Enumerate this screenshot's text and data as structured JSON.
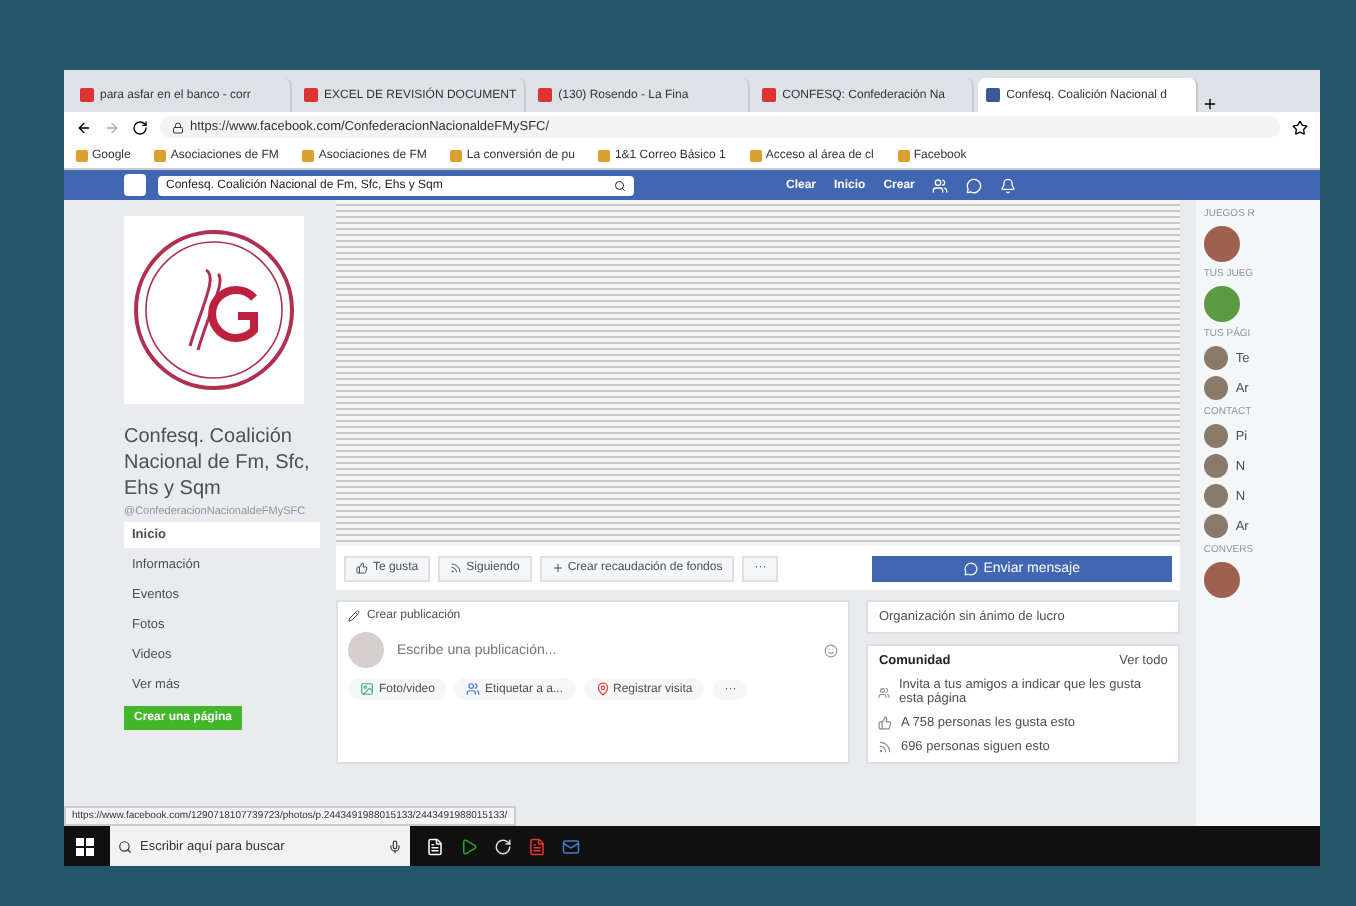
{
  "browser": {
    "tabs": [
      {
        "title": "para asfar en el banco - corr",
        "selected": false
      },
      {
        "title": "EXCEL DE REVISIÓN DOCUMENT",
        "selected": false
      },
      {
        "title": "(130) Rosendo - La Fina",
        "selected": false
      },
      {
        "title": "CONFESQ: Confederación Na",
        "selected": false
      },
      {
        "title": "Confesq. Coalición Nacional d",
        "selected": true
      }
    ],
    "address": "https://www.facebook.com/ConfederacionNacionaldeFMySFC/",
    "bookmarks": [
      "Google",
      "Asociaciones de FM",
      "Asociaciones de FM",
      "La conversión de pu",
      "1&1 Correo Básico 1",
      "Acceso al área de cl",
      "Facebook"
    ]
  },
  "topbar": {
    "search": "Confesq. Coalición Nacional de Fm, Sfc, Ehs y Sqm",
    "links": [
      "Clear",
      "Inicio",
      "Crear"
    ]
  },
  "page": {
    "name": "Confesq. Coalición Nacional de Fm, Sfc, Ehs y Sqm",
    "handle": "@ConfederacionNacionaldeFMySFC",
    "nav": [
      {
        "label": "Inicio",
        "selected": true
      },
      {
        "label": "Información",
        "selected": false
      },
      {
        "label": "Eventos",
        "selected": false
      },
      {
        "label": "Fotos",
        "selected": false
      },
      {
        "label": "Videos",
        "selected": false
      }
    ],
    "more": "Ver más",
    "create_page": "Crear una página"
  },
  "actions": {
    "like": "Te gusta",
    "follow": "Siguiendo",
    "fundraiser": "Crear recaudación de fondos",
    "more": "···",
    "message": "Enviar mensaje"
  },
  "composer": {
    "title": "Crear publicación",
    "placeholder": "Escribe una publicación...",
    "buttons": [
      "Foto/video",
      "Etiquetar a a...",
      "Registrar visita"
    ],
    "more": "···"
  },
  "about": {
    "category": "Organización sin ánimo de lucro"
  },
  "community": {
    "title": "Comunidad",
    "see_all": "Ver todo",
    "items": [
      "Invita a tus amigos a indicar que les gusta esta página",
      "A 758 personas les gusta esto",
      "696 personas siguen esto"
    ]
  },
  "sidebar": {
    "sections": [
      {
        "title": "JUEGOS R"
      },
      {
        "title": "TUS JUEG"
      },
      {
        "title": "TUS PÁGI",
        "items": [
          "Te",
          "Ar"
        ]
      },
      {
        "title": "CONTACT",
        "items": [
          "Pi",
          "N",
          "N",
          "Ar"
        ]
      },
      {
        "title": "CONVERS"
      }
    ]
  },
  "status_url": "https://www.facebook.com/1290718107739723/photos/p.2443491988015133/2443491988015133/",
  "taskbar": {
    "search": "Escribir aquí para buscar"
  }
}
